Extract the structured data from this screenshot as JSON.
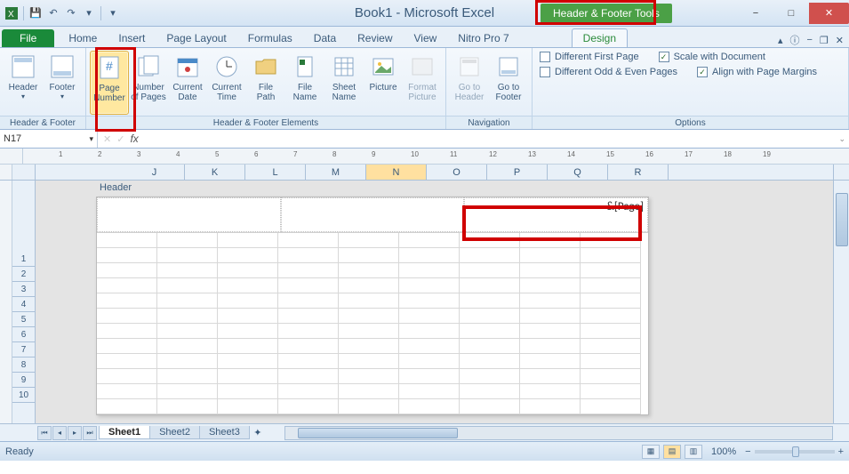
{
  "title": {
    "doc": "Book1",
    "app": "Microsoft Excel",
    "sep": " - "
  },
  "contextual_tab_title": "Header & Footer Tools",
  "tabs": {
    "file": "File",
    "items": [
      "Home",
      "Insert",
      "Page Layout",
      "Formulas",
      "Data",
      "Review",
      "View",
      "Nitro Pro 7"
    ],
    "design": "Design"
  },
  "ribbon": {
    "groups": {
      "hf": {
        "label": "Header & Footer",
        "header": "Header",
        "footer": "Footer"
      },
      "elements": {
        "label": "Header & Footer Elements",
        "page_number": "Page\nNumber",
        "number_of_pages": "Number\nof Pages",
        "current_date": "Current\nDate",
        "current_time": "Current\nTime",
        "file_path": "File\nPath",
        "file_name": "File\nName",
        "sheet_name": "Sheet\nName",
        "picture": "Picture",
        "format_picture": "Format\nPicture"
      },
      "nav": {
        "label": "Navigation",
        "goto_header": "Go to\nHeader",
        "goto_footer": "Go to\nFooter"
      },
      "options": {
        "label": "Options",
        "diff_first": "Different First Page",
        "diff_odd_even": "Different Odd & Even Pages",
        "scale": "Scale with Document",
        "align": "Align with Page Margins",
        "scale_checked": true,
        "align_checked": true,
        "diff_first_checked": false,
        "diff_odd_even_checked": false
      }
    }
  },
  "name_box": "N17",
  "fx_label": "fx",
  "ruler_numbers": [
    "1",
    "2",
    "3",
    "4",
    "5",
    "6",
    "7",
    "8",
    "9",
    "10",
    "11",
    "12",
    "13",
    "14",
    "15",
    "16",
    "17",
    "18",
    "19"
  ],
  "columns": [
    "J",
    "K",
    "L",
    "M",
    "N",
    "O",
    "P",
    "Q",
    "R"
  ],
  "active_column": "N",
  "row_numbers": [
    "1",
    "2",
    "3",
    "4",
    "5",
    "6",
    "7",
    "8",
    "9",
    "10"
  ],
  "header_section_label": "Header",
  "header_right_value": "&[Page]",
  "sheet_tabs": {
    "items": [
      "Sheet1",
      "Sheet2",
      "Sheet3"
    ],
    "active": "Sheet1"
  },
  "status": {
    "left": "Ready",
    "zoom": "100%"
  },
  "glyphs": {
    "check": "✓",
    "minus": "−",
    "plus": "+",
    "caret_down": "▾",
    "tri_l": "◂",
    "tri_r": "▸",
    "first": "⏮",
    "last": "⏭",
    "box": "□",
    "help": "?",
    "up": "▴"
  }
}
